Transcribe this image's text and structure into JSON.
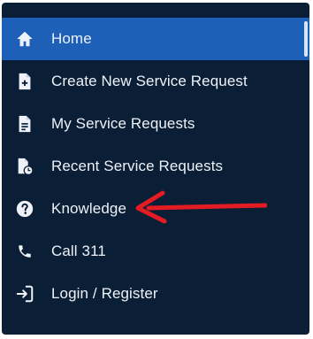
{
  "menu": {
    "items": [
      {
        "label": "Home",
        "icon": "home-icon",
        "active": true
      },
      {
        "label": "Create New Service Request",
        "icon": "file-plus-icon"
      },
      {
        "label": "My Service Requests",
        "icon": "file-text-icon"
      },
      {
        "label": "Recent Service Requests",
        "icon": "file-clock-icon"
      },
      {
        "label": "Knowledge",
        "icon": "question-circle-icon"
      },
      {
        "label": "Call 311",
        "icon": "phone-icon"
      },
      {
        "label": "Login / Register",
        "icon": "login-icon"
      }
    ]
  },
  "colors": {
    "background": "#0a1e36",
    "active": "#1e5fb8",
    "text": "#eef2f8",
    "annotation_arrow": "#e31b23"
  },
  "annotation": {
    "type": "arrow",
    "points_to": "Knowledge"
  }
}
